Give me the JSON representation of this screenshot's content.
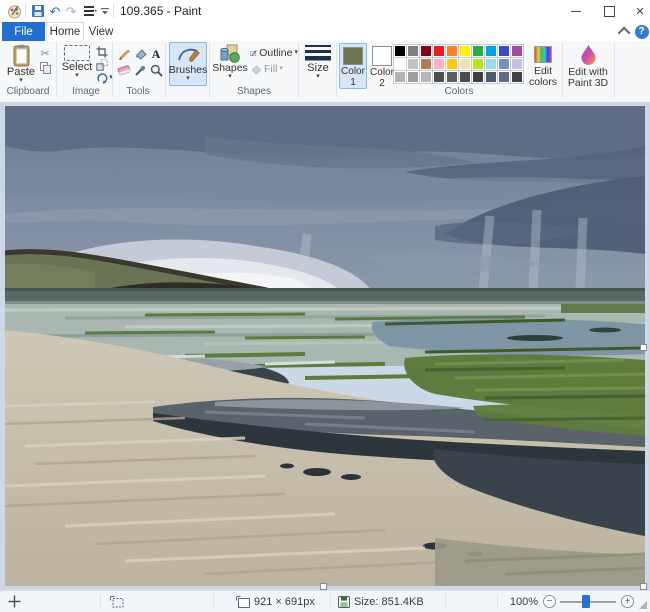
{
  "icons": {
    "caret": "▾",
    "cut": "✂",
    "undo": "↶",
    "redo": "↷",
    "close": "✕",
    "help": "?",
    "text_tool": "A",
    "zoom_out": "−",
    "zoom_in": "+"
  },
  "titlebar": {
    "title": "109.365 - Paint"
  },
  "tabs": {
    "file": "File",
    "home": "Home",
    "view": "View"
  },
  "ribbon": {
    "clipboard": {
      "caption": "Clipboard",
      "paste": "Paste"
    },
    "image": {
      "caption": "Image",
      "select": "Select"
    },
    "tools": {
      "caption": "Tools"
    },
    "brushes": {
      "label": "Brushes"
    },
    "shapes": {
      "caption": "Shapes",
      "shapes_label": "Shapes",
      "outline": "Outline",
      "fill": "Fill"
    },
    "size": {
      "label": "Size"
    },
    "colors": {
      "caption": "Colors",
      "color1_label": "Color",
      "color1_number": "1",
      "color1_value": "#6E7553",
      "color2_label": "Color",
      "color2_number": "2",
      "color2_value": "#FFFFFF",
      "edit_colors": "Edit colors",
      "palette": [
        "#000000",
        "#7F7F7F",
        "#880015",
        "#ED1C24",
        "#FF7F27",
        "#FFF200",
        "#22B14C",
        "#00A2E8",
        "#3F48CC",
        "#A349A4",
        "#FFFFFF",
        "#C3C3C3",
        "#B97A57",
        "#FFAEC9",
        "#FFC90E",
        "#EFE4B0",
        "#B5E61D",
        "#99D9EA",
        "#7092BE",
        "#C8BFE7",
        "#B2B2B0",
        "#9E9E9C",
        "#B6B6B4",
        "#49514A",
        "#5E605E",
        "#4B4B49",
        "#3D3F41",
        "#4C5A70",
        "#5D6B85",
        "#3F4348"
      ]
    },
    "paint3d": {
      "label": "Edit with Paint 3D"
    }
  },
  "statusbar": {
    "canvas_size": "921 × 691px",
    "file_size": "Size: 851.4KB",
    "zoom_level": "100%"
  }
}
